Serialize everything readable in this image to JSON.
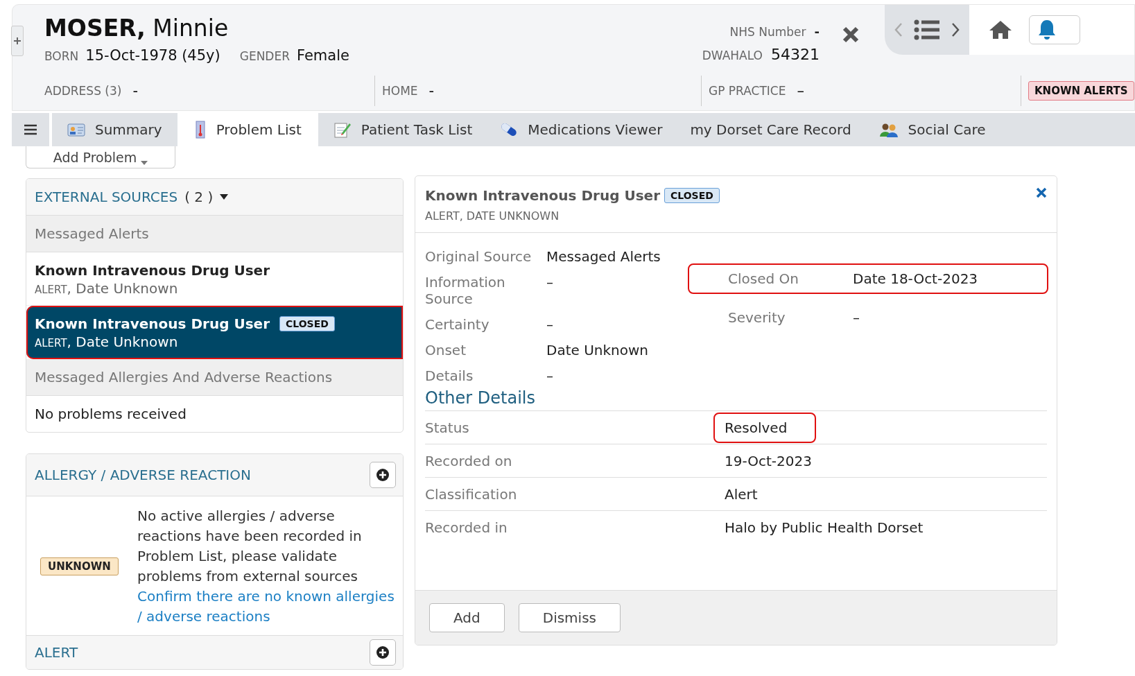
{
  "patient": {
    "surname": "MOSER,",
    "forename": "Minnie",
    "born_label": "BORN",
    "born": "15-Oct-1978 (45y)",
    "gender_label": "GENDER",
    "gender": "Female",
    "nhs_label": "NHS Number",
    "nhs": "-",
    "local_label": "DWAHALO",
    "local": "54321"
  },
  "contact_fields": [
    {
      "label": "ADDRESS (3)",
      "value": "-"
    },
    {
      "label": "HOME",
      "value": "-"
    },
    {
      "label": "GP PRACTICE",
      "value": "–"
    }
  ],
  "alert_badge": "KNOWN ALERTS",
  "tabs": [
    {
      "label": "Summary",
      "selected": false
    },
    {
      "label": "Problem List",
      "selected": true
    },
    {
      "label": "Patient Task List",
      "selected": false
    },
    {
      "label": "Medications Viewer",
      "selected": false
    },
    {
      "label": "my Dorset Care Record",
      "selected": false
    },
    {
      "label": "Social Care",
      "selected": false
    }
  ],
  "add_problem": "Add Problem",
  "external_sources": {
    "title": "EXTERNAL SOURCES",
    "count": "( 2 )",
    "groups": [
      {
        "heading": "Messaged Alerts",
        "items": [
          {
            "title": "Known Intravenous Drug User",
            "type": "ALERT",
            "date": ", Date Unknown",
            "selected": false,
            "highlighted": false
          },
          {
            "title": "Known Intravenous Drug User",
            "type": "ALERT",
            "date": ", Date Unknown",
            "badge": "CLOSED",
            "selected": true,
            "highlighted": true
          }
        ]
      },
      {
        "heading": "Messaged Allergies And Adverse Reactions",
        "empty": "No problems received"
      }
    ]
  },
  "allergy": {
    "title": "ALLERGY / ADVERSE REACTION",
    "badge": "UNKNOWN",
    "message": "No active allergies / adverse reactions have been recorded in Problem List, please validate problems from external sources",
    "link": "Confirm there are no known allergies / adverse reactions"
  },
  "alert_panel": {
    "title": "ALERT"
  },
  "detail": {
    "title": "Known Intravenous Drug User",
    "badge": "CLOSED",
    "subtitle": "ALERT, DATE UNKNOWN",
    "left_fields": [
      {
        "label": "Original Source",
        "value": "Messaged Alerts"
      },
      {
        "label": "Information Source",
        "value": "–"
      },
      {
        "label": "Certainty",
        "value": "–"
      },
      {
        "label": "Onset",
        "value": "Date Unknown"
      },
      {
        "label": "Details",
        "value": "–"
      }
    ],
    "right_fields": [
      {
        "label": "Closed On",
        "value": "Date 18-Oct-2023",
        "highlighted": true
      },
      {
        "label": "Severity",
        "value": "–",
        "highlighted": false
      }
    ],
    "section": "Other Details",
    "rows": [
      {
        "label": "Status",
        "value": "Resolved",
        "highlighted": true
      },
      {
        "label": "Recorded on",
        "value": "19-Oct-2023",
        "highlighted": false
      },
      {
        "label": "Classification",
        "value": "Alert",
        "highlighted": false
      },
      {
        "label": "Recorded in",
        "value": "Halo by Public Health Dorset",
        "highlighted": false
      }
    ],
    "buttons": [
      "Add",
      "Dismiss"
    ]
  }
}
